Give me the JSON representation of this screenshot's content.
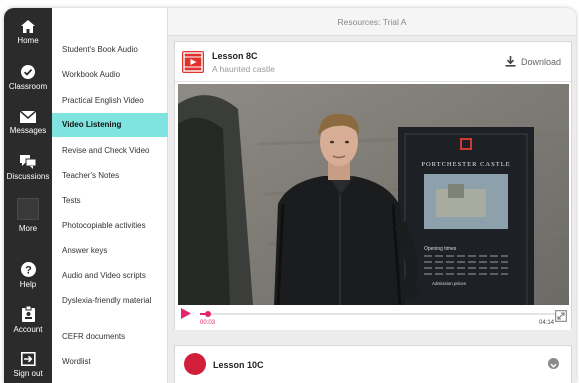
{
  "header": {
    "title": "Resources: Trial A"
  },
  "rail": {
    "items": [
      {
        "label": "Home",
        "icon": "home-icon"
      },
      {
        "label": "Classroom",
        "icon": "check-circle-icon"
      },
      {
        "label": "Messages",
        "icon": "envelope-icon"
      },
      {
        "label": "Discussions",
        "icon": "chat-bubbles-icon"
      },
      {
        "label": "More",
        "icon": "more-icon"
      },
      {
        "label": "Help",
        "icon": "help-icon"
      },
      {
        "label": "Account",
        "icon": "account-badge-icon"
      },
      {
        "label": "Sign out",
        "icon": "sign-out-icon"
      }
    ]
  },
  "menu": {
    "items": [
      {
        "label": "Student's Book Audio"
      },
      {
        "label": "Workbook Audio"
      },
      {
        "label": "Practical English Video"
      },
      {
        "label": "Video Listening",
        "active": true
      },
      {
        "label": "Revise and Check Video"
      },
      {
        "label": "Teacher's Notes"
      },
      {
        "label": "Tests"
      },
      {
        "label": "Photocopiable activities"
      },
      {
        "label": "Answer keys"
      },
      {
        "label": "Audio and Video scripts"
      },
      {
        "label": "Dyslexia-friendly material"
      },
      {
        "label": "CEFR documents"
      },
      {
        "label": "Wordlist"
      }
    ]
  },
  "lesson": {
    "title": "Lesson 8C",
    "subtitle": "A haunted castle",
    "download_label": "Download",
    "video": {
      "sign_title": "PORTCHESTER CASTLE",
      "sign_opening": "Opening times",
      "sign_prices": "Admission prices",
      "current_time": "00:03",
      "duration": "04:14",
      "progress": 0.012
    }
  },
  "lesson2": {
    "title": "Lesson 10C"
  },
  "colors": {
    "accent": "#7fe3df",
    "brand_red": "#e0322d",
    "progress": "#e6236e",
    "rail": "#2b2b2b"
  }
}
